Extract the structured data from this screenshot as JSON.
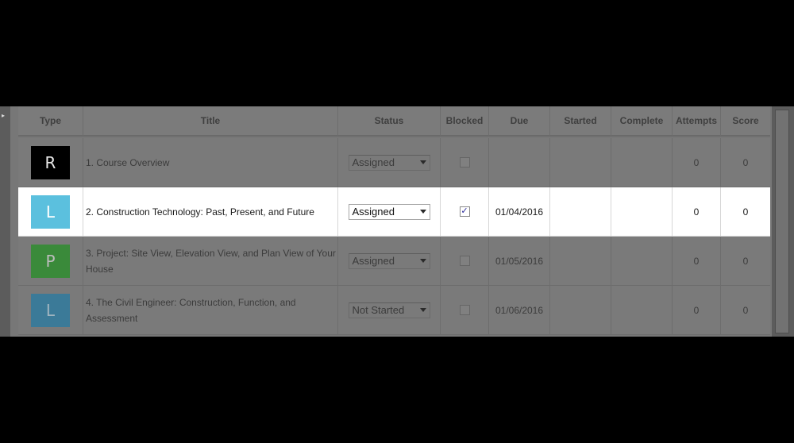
{
  "columns": {
    "type": "Type",
    "title": "Title",
    "status": "Status",
    "blocked": "Blocked",
    "due": "Due",
    "started": "Started",
    "complete": "Complete",
    "attempts": "Attempts",
    "score": "Score"
  },
  "rows": [
    {
      "type_letter": "R",
      "type_color": "#000000",
      "title": "1. Course Overview",
      "status": "Assigned",
      "blocked": false,
      "due": "",
      "started": "",
      "complete": "",
      "attempts": "0",
      "score": "0",
      "active": false
    },
    {
      "type_letter": "L",
      "type_color": "#5bc0de",
      "title": "2. Construction Technology: Past, Present, and Future",
      "status": "Assigned",
      "blocked": true,
      "blocked_mark": "✓",
      "due": "01/04/2016",
      "started": "",
      "complete": "",
      "attempts": "0",
      "score": "0",
      "active": true
    },
    {
      "type_letter": "P",
      "type_color": "#3a8a3a",
      "title": "3. Project: Site View, Elevation View, and Plan View of Your House",
      "status": "Assigned",
      "blocked": false,
      "due": "01/05/2016",
      "started": "",
      "complete": "",
      "attempts": "0",
      "score": "0",
      "active": false
    },
    {
      "type_letter": "L",
      "type_color": "#3b7a98",
      "title": "4. The Civil Engineer: Construction, Function, and Assessment",
      "status": "Not Started",
      "blocked": false,
      "due": "01/06/2016",
      "started": "",
      "complete": "",
      "attempts": "0",
      "score": "0",
      "active": false
    }
  ],
  "icons": {
    "scroll_left": "triangle-right-icon",
    "dropdown": "caret-down-icon",
    "checkbox_checked": "check-icon"
  }
}
